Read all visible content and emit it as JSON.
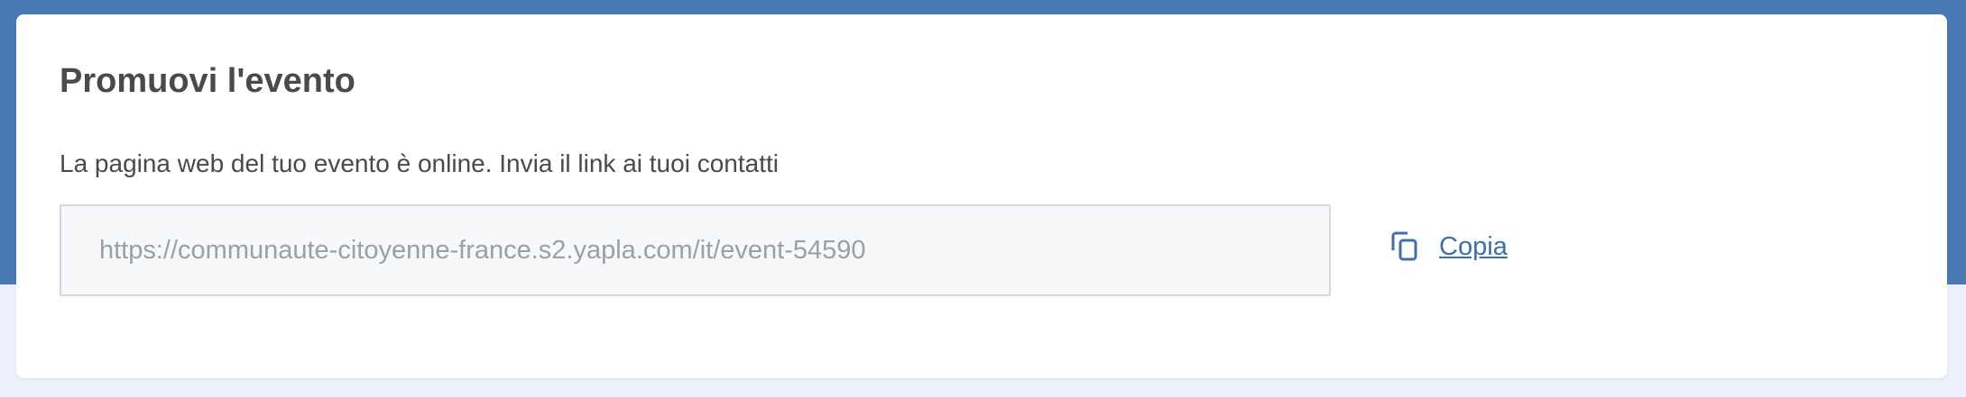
{
  "card": {
    "title": "Promuovi l'evento",
    "description": "La pagina web del tuo evento è online. Invia il link ai tuoi contatti",
    "link_field": {
      "value": "https://communaute-citoyenne-france.s2.yapla.com/it/event-54590"
    },
    "copy_action": {
      "icon": "copy-icon",
      "label": "Copia"
    }
  },
  "colors": {
    "header_band": "#4a7ab5",
    "page_background": "#eef1fb",
    "link_color": "#3f6ea8",
    "text_color": "#4a4a4a"
  }
}
